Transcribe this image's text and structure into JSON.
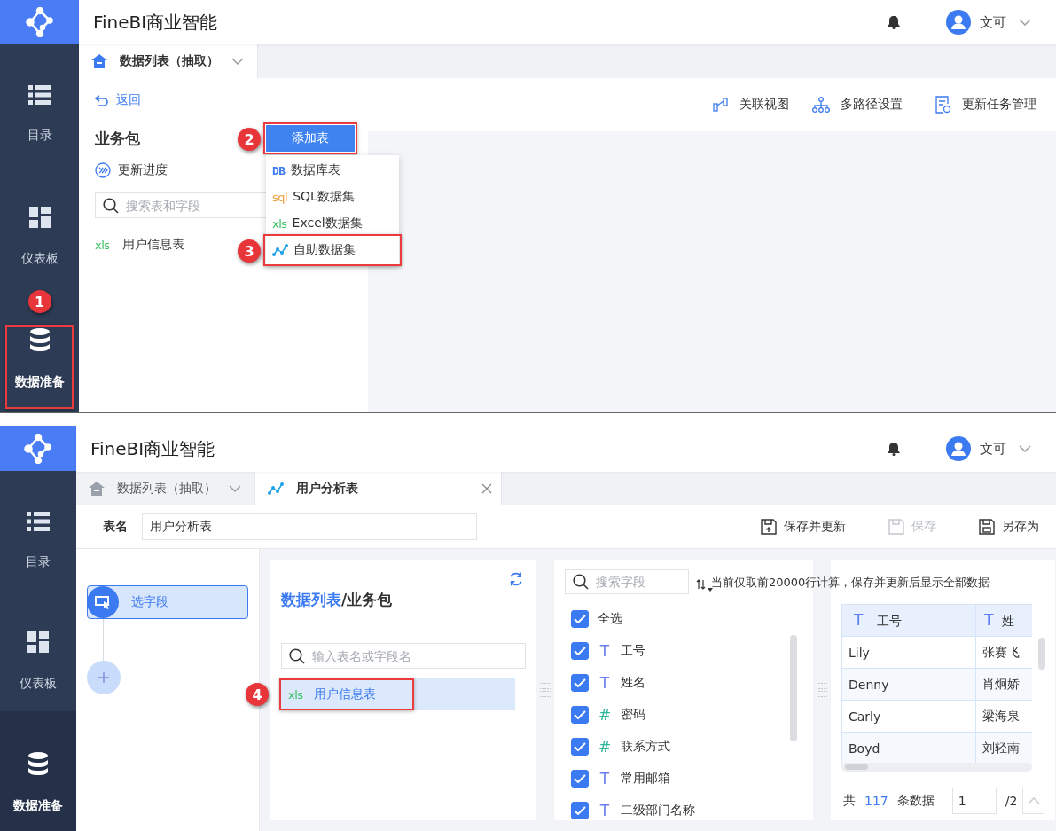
{
  "screen_1": {
    "app_title": "FineBI商业智能",
    "user": "文可",
    "nav": [
      {
        "kind": "catalog",
        "label": "目录",
        "selected": false
      },
      {
        "kind": "dashboard",
        "label": "仪表板",
        "selected": false
      },
      {
        "kind": "data",
        "label": "数据准备",
        "selected": true
      }
    ],
    "tabs": [
      {
        "kind": "home",
        "label": "数据列表（抽取）",
        "selected": true
      }
    ],
    "back": "返回",
    "toolbar": [
      {
        "kind": "relation",
        "label": "关联视图"
      },
      {
        "kind": "paths",
        "label": "多路径设置"
      },
      {
        "kind": "tasks",
        "label": "更新任务管理"
      }
    ],
    "package_title": "业务包",
    "add_button": "添加表",
    "update_progress": "更新进度",
    "search": {
      "placeholder": "搜索表和字段"
    },
    "tables": [
      {
        "type_mark": "xls",
        "label": "用户信息表"
      }
    ],
    "menu": [
      {
        "kind": "db",
        "mark": "DB",
        "label": "数据库表"
      },
      {
        "kind": "sql",
        "mark": "sql",
        "label": "SQL数据集"
      },
      {
        "kind": "excel",
        "mark": "xls",
        "label": "Excel数据集"
      },
      {
        "kind": "self",
        "label": "自助数据集"
      }
    ]
  },
  "screen_2": {
    "app_title": "FineBI商业智能",
    "user": "文可",
    "nav": [
      {
        "kind": "catalog",
        "label": "目录",
        "selected": false
      },
      {
        "kind": "dashboard",
        "label": "仪表板",
        "selected": false
      },
      {
        "kind": "data",
        "label": "数据准备",
        "selected": true
      }
    ],
    "tabs": [
      {
        "kind": "home",
        "label": "数据列表（抽取）",
        "selected": false
      },
      {
        "kind": "dataset",
        "label": "用户分析表",
        "selected": true
      }
    ],
    "table_name_label": "表名",
    "table_name": "用户分析表",
    "actions": [
      {
        "kind": "save-update",
        "label": "保存并更新",
        "disabled": false
      },
      {
        "kind": "save",
        "label": "保存",
        "disabled": true
      },
      {
        "kind": "save-as",
        "label": "另存为",
        "disabled": false
      }
    ],
    "steps": [
      {
        "label": "选字段",
        "selected": true
      }
    ],
    "source": {
      "title_link": "数据列表",
      "title_rest": "/业务包",
      "search": {
        "placeholder": "输入表名或字段名"
      },
      "tables": [
        {
          "type_mark": "xls",
          "label": "用户信息表",
          "selected": true
        }
      ]
    },
    "fields": {
      "search": {
        "placeholder": "搜索字段"
      },
      "notice": "当前仅取前20000行计算，保存并更新后显示全部数据",
      "select_all": {
        "label": "全选",
        "checked": true
      },
      "items": [
        {
          "kind": "text",
          "type_mark": "T",
          "label": "工号",
          "checked": true
        },
        {
          "kind": "text",
          "type_mark": "T",
          "label": "姓名",
          "checked": true
        },
        {
          "kind": "number",
          "type_mark": "#",
          "label": "密码",
          "checked": true
        },
        {
          "kind": "number",
          "type_mark": "#",
          "label": "联系方式",
          "checked": true
        },
        {
          "kind": "text",
          "type_mark": "T",
          "label": "常用邮箱",
          "checked": true
        },
        {
          "kind": "text",
          "type_mark": "T",
          "label": "二级部门名称",
          "checked": true
        }
      ]
    },
    "preview": {
      "columns": [
        {
          "type_mark": "T",
          "label": "工号"
        },
        {
          "type_mark": "T",
          "label": "姓"
        }
      ],
      "rows": [
        [
          "Lily",
          "张赛飞"
        ],
        [
          "Denny",
          "肖炯娇"
        ],
        [
          "Carly",
          "梁海泉"
        ],
        [
          "Boyd",
          "刘轻南"
        ]
      ],
      "footer": {
        "prefix": "共",
        "count": "117",
        "suffix": "条数据",
        "page": "1",
        "pages": "/2"
      }
    }
  },
  "annotations": [
    "1",
    "2",
    "3",
    "4"
  ]
}
